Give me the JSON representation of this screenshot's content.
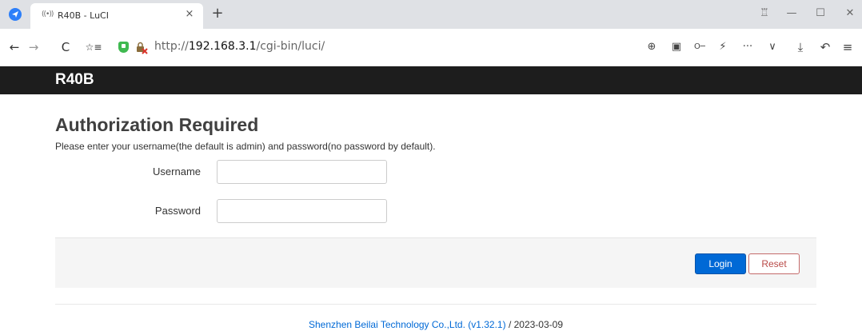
{
  "browser": {
    "tab_favicon": "((•))",
    "tab_title": "R40B - LuCI",
    "tab_close": "×",
    "new_tab": "+",
    "url_prefix": "http://",
    "url_host": "192.168.3.1",
    "url_path": "/cgi-bin/luci/",
    "icons": {
      "back": "←",
      "forward": "→",
      "reload": "C",
      "bookmark": "☆≡",
      "zoom": "⊕",
      "translate": "▣",
      "password": "O─",
      "flash": "⚡",
      "more": "···",
      "dropdown": "∨",
      "download": "⤓",
      "undo": "↶",
      "menu": "≡",
      "shirt": "♖",
      "minimize": "—",
      "maximize": "☐",
      "close": "✕"
    }
  },
  "header": {
    "brand": "R40B"
  },
  "login": {
    "title": "Authorization Required",
    "description": "Please enter your username(the default is admin) and password(no password by default).",
    "username_label": "Username",
    "username_value": "",
    "password_label": "Password",
    "password_value": "",
    "login_button": "Login",
    "reset_button": "Reset"
  },
  "footer": {
    "link_text": "Shenzhen Beilai Technology Co.,Ltd. (v1.32.1)",
    "suffix": " / 2023-03-09"
  },
  "colors": {
    "accent": "#0069d6",
    "reset": "#b94a48",
    "header_bg": "#1d1d1d"
  }
}
